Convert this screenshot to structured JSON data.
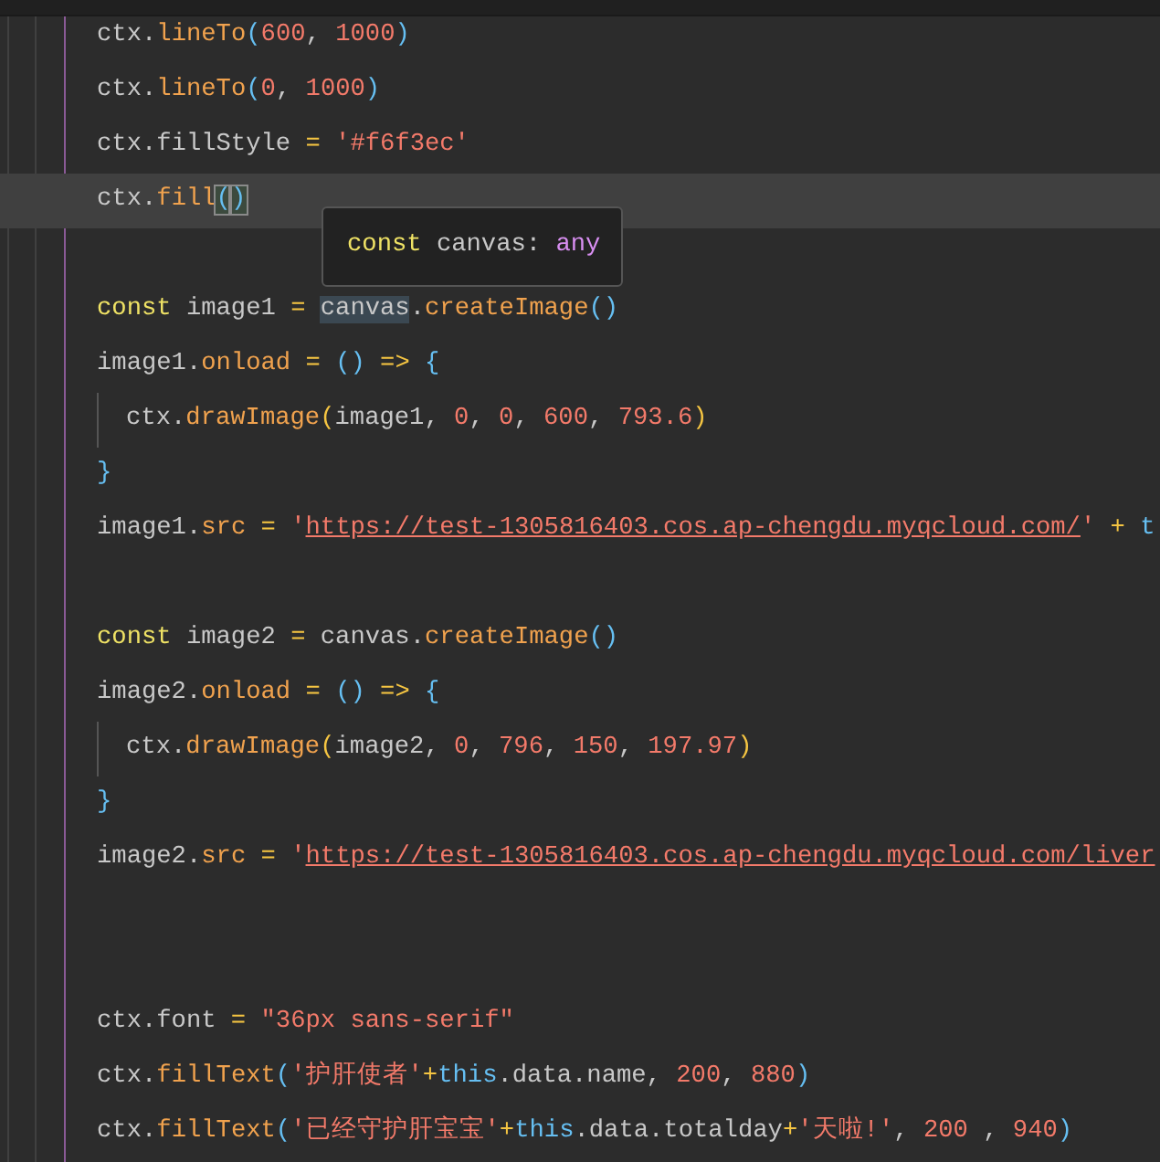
{
  "editor": {
    "lines": [
      {
        "kind": "code",
        "current": false,
        "tokens": [
          {
            "text": "ctx",
            "kind": "id"
          },
          {
            "text": ".",
            "kind": "id"
          },
          {
            "text": "lineTo",
            "kind": "fn"
          },
          {
            "text": "(",
            "kind": "paren"
          },
          {
            "text": "600",
            "kind": "num"
          },
          {
            "text": ", ",
            "kind": "id"
          },
          {
            "text": "1000",
            "kind": "num"
          },
          {
            "text": ")",
            "kind": "paren"
          }
        ]
      },
      {
        "kind": "code",
        "current": false,
        "tokens": [
          {
            "text": "ctx",
            "kind": "id"
          },
          {
            "text": ".",
            "kind": "id"
          },
          {
            "text": "lineTo",
            "kind": "fn"
          },
          {
            "text": "(",
            "kind": "paren"
          },
          {
            "text": "0",
            "kind": "num"
          },
          {
            "text": ", ",
            "kind": "id"
          },
          {
            "text": "1000",
            "kind": "num"
          },
          {
            "text": ")",
            "kind": "paren"
          }
        ]
      },
      {
        "kind": "code",
        "current": false,
        "tokens": [
          {
            "text": "ctx.fillStyle",
            "kind": "id"
          },
          {
            "text": " = ",
            "kind": "op"
          },
          {
            "text": "'#f6f3ec'",
            "kind": "str"
          }
        ]
      },
      {
        "kind": "code",
        "current": true,
        "tokens": [
          {
            "text": "ctx",
            "kind": "id"
          },
          {
            "text": ".",
            "kind": "id"
          },
          {
            "text": "fill",
            "kind": "fn"
          },
          {
            "text": "(",
            "kind": "paren",
            "boxed": true
          },
          {
            "text": ")",
            "kind": "paren",
            "boxed": true
          }
        ]
      },
      {
        "kind": "blank"
      },
      {
        "kind": "code",
        "current": false,
        "tokens": [
          {
            "text": "const",
            "kind": "kw"
          },
          {
            "text": " image1",
            "kind": "id"
          },
          {
            "text": " = ",
            "kind": "op"
          },
          {
            "text": "canvas",
            "kind": "id",
            "boxed": true
          },
          {
            "text": ".",
            "kind": "id"
          },
          {
            "text": "createImage",
            "kind": "fn"
          },
          {
            "text": "()",
            "kind": "paren"
          }
        ]
      },
      {
        "kind": "code",
        "current": false,
        "tokens": [
          {
            "text": "image1",
            "kind": "id"
          },
          {
            "text": ".",
            "kind": "id"
          },
          {
            "text": "onload",
            "kind": "fn"
          },
          {
            "text": " = ",
            "kind": "op"
          },
          {
            "text": "()",
            "kind": "paren"
          },
          {
            "text": " => ",
            "kind": "op"
          },
          {
            "text": "{",
            "kind": "paren"
          }
        ],
        "children": [
          {
            "kind": "code",
            "current": false,
            "tokens": [
              {
                "text": "ctx",
                "kind": "id"
              },
              {
                "text": ".",
                "kind": "id"
              },
              {
                "text": "drawImage",
                "kind": "fn"
              },
              {
                "text": "(",
                "kind": "paren2"
              },
              {
                "text": "image1, ",
                "kind": "id"
              },
              {
                "text": "0",
                "kind": "num"
              },
              {
                "text": ", ",
                "kind": "id"
              },
              {
                "text": "0",
                "kind": "num"
              },
              {
                "text": ", ",
                "kind": "id"
              },
              {
                "text": "600",
                "kind": "num"
              },
              {
                "text": ", ",
                "kind": "id"
              },
              {
                "text": "793.6",
                "kind": "num"
              },
              {
                "text": ")",
                "kind": "paren2"
              }
            ]
          }
        ]
      },
      {
        "kind": "code",
        "current": false,
        "tokens": [
          {
            "text": "}",
            "kind": "paren"
          }
        ]
      },
      {
        "kind": "code",
        "current": false,
        "tokens": [
          {
            "text": "image1",
            "kind": "id"
          },
          {
            "text": ".",
            "kind": "id"
          },
          {
            "text": "src",
            "kind": "fn"
          },
          {
            "text": " = ",
            "kind": "op"
          },
          {
            "text": "'",
            "kind": "str"
          },
          {
            "text": "https://test-1305816403.cos.ap-chengdu.myqcloud.com/",
            "kind": "url"
          },
          {
            "text": "'",
            "kind": "str"
          },
          {
            "text": " + ",
            "kind": "op"
          },
          {
            "text": "t",
            "kind": "this"
          }
        ]
      },
      {
        "kind": "blank"
      },
      {
        "kind": "code",
        "current": false,
        "tokens": [
          {
            "text": "const",
            "kind": "kw"
          },
          {
            "text": " image2 ",
            "kind": "id"
          },
          {
            "text": "=",
            "kind": "op"
          },
          {
            "text": " canvas.",
            "kind": "id"
          },
          {
            "text": "createImage",
            "kind": "fn"
          },
          {
            "text": "()",
            "kind": "paren"
          }
        ]
      },
      {
        "kind": "code",
        "current": false,
        "tokens": [
          {
            "text": "image2",
            "kind": "id"
          },
          {
            "text": ".",
            "kind": "id"
          },
          {
            "text": "onload",
            "kind": "fn"
          },
          {
            "text": " = ",
            "kind": "op"
          },
          {
            "text": "()",
            "kind": "paren"
          },
          {
            "text": " => ",
            "kind": "op"
          },
          {
            "text": "{",
            "kind": "paren"
          }
        ],
        "children": [
          {
            "kind": "code",
            "current": false,
            "tokens": [
              {
                "text": "ctx",
                "kind": "id"
              },
              {
                "text": ".",
                "kind": "id"
              },
              {
                "text": "drawImage",
                "kind": "fn"
              },
              {
                "text": "(",
                "kind": "paren2"
              },
              {
                "text": "image2, ",
                "kind": "id"
              },
              {
                "text": "0",
                "kind": "num"
              },
              {
                "text": ", ",
                "kind": "id"
              },
              {
                "text": "796",
                "kind": "num"
              },
              {
                "text": ", ",
                "kind": "id"
              },
              {
                "text": "150",
                "kind": "num"
              },
              {
                "text": ", ",
                "kind": "id"
              },
              {
                "text": "197.97",
                "kind": "num"
              },
              {
                "text": ")",
                "kind": "paren2"
              }
            ]
          }
        ]
      },
      {
        "kind": "code",
        "current": false,
        "tokens": [
          {
            "text": "}",
            "kind": "paren"
          }
        ]
      },
      {
        "kind": "code",
        "current": false,
        "tokens": [
          {
            "text": "image2",
            "kind": "id"
          },
          {
            "text": ".",
            "kind": "id"
          },
          {
            "text": "src",
            "kind": "fn"
          },
          {
            "text": " = ",
            "kind": "op"
          },
          {
            "text": "'",
            "kind": "str"
          },
          {
            "text": "https://test-1305816403.cos.ap-chengdu.myqcloud.com/liver",
            "kind": "url"
          }
        ]
      },
      {
        "kind": "blank"
      },
      {
        "kind": "blank"
      },
      {
        "kind": "code",
        "current": false,
        "tokens": [
          {
            "text": "ctx.font",
            "kind": "id"
          },
          {
            "text": " = ",
            "kind": "op"
          },
          {
            "text": "\"36px sans-serif\"",
            "kind": "str"
          }
        ]
      },
      {
        "kind": "code",
        "current": false,
        "tokens": [
          {
            "text": "ctx",
            "kind": "id"
          },
          {
            "text": ".",
            "kind": "id"
          },
          {
            "text": "fillText",
            "kind": "fn"
          },
          {
            "text": "(",
            "kind": "paren"
          },
          {
            "text": "'护肝使者'",
            "kind": "str"
          },
          {
            "text": "+",
            "kind": "op"
          },
          {
            "text": "this",
            "kind": "this"
          },
          {
            "text": ".data.name, ",
            "kind": "id"
          },
          {
            "text": "200",
            "kind": "num"
          },
          {
            "text": ", ",
            "kind": "id"
          },
          {
            "text": "880",
            "kind": "num"
          },
          {
            "text": ")",
            "kind": "paren"
          }
        ]
      },
      {
        "kind": "code",
        "current": false,
        "tokens": [
          {
            "text": "ctx",
            "kind": "id"
          },
          {
            "text": ".",
            "kind": "id"
          },
          {
            "text": "fillText",
            "kind": "fn"
          },
          {
            "text": "(",
            "kind": "paren"
          },
          {
            "text": "'已经守护肝宝宝'",
            "kind": "str"
          },
          {
            "text": "+",
            "kind": "op"
          },
          {
            "text": "this",
            "kind": "this"
          },
          {
            "text": ".data.totalday",
            "kind": "id"
          },
          {
            "text": "+",
            "kind": "op"
          },
          {
            "text": "'天啦!'",
            "kind": "str"
          },
          {
            "text": ", ",
            "kind": "id"
          },
          {
            "text": "200",
            "kind": "num"
          },
          {
            "text": " , ",
            "kind": "id"
          },
          {
            "text": "940",
            "kind": "num"
          },
          {
            "text": ")",
            "kind": "paren"
          }
        ]
      }
    ]
  },
  "tooltip": {
    "tokens": [
      {
        "text": "const",
        "kind": "kw"
      },
      {
        "text": " canvas: ",
        "kind": "id"
      },
      {
        "text": "any",
        "kind": "type"
      }
    ]
  }
}
